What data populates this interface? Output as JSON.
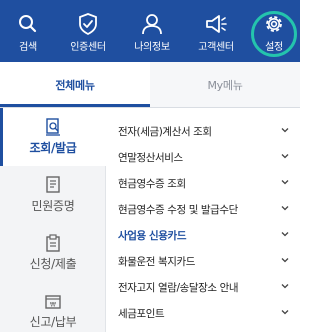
{
  "topbar": {
    "items": [
      {
        "label": "검색",
        "icon": "search-icon"
      },
      {
        "label": "인증센터",
        "icon": "shield-check-icon"
      },
      {
        "label": "나의정보",
        "icon": "user-icon"
      },
      {
        "label": "고객센터",
        "icon": "megaphone-icon"
      },
      {
        "label": "설정",
        "icon": "gear-icon"
      }
    ],
    "bg_color": "#1f4fa0",
    "highlight_ring_color": "#24c4ad"
  },
  "tabs": [
    {
      "label": "전체메뉴",
      "active": true
    },
    {
      "label": "My메뉴",
      "active": false
    }
  ],
  "categories": [
    {
      "label": "조회/발급",
      "icon": "document-search-icon",
      "active": true
    },
    {
      "label": "민원증명",
      "icon": "certificate-icon",
      "active": false
    },
    {
      "label": "신청/제출",
      "icon": "clipboard-icon",
      "active": false
    },
    {
      "label": "신고/납부",
      "icon": "tax-payment-icon",
      "active": false
    }
  ],
  "menu_items": [
    {
      "label": "전자(세금)계산서 조회",
      "highlight": false
    },
    {
      "label": "연말정산서비스",
      "highlight": false
    },
    {
      "label": "현금영수증 조회",
      "highlight": false
    },
    {
      "label": "현금영수증 수정 및 발급수단",
      "highlight": false
    },
    {
      "label": "사업용 신용카드",
      "highlight": true
    },
    {
      "label": "화물운전 복지카드",
      "highlight": false
    },
    {
      "label": "전자고지 열람/송달장소 안내",
      "highlight": false
    },
    {
      "label": "세금포인트",
      "highlight": false
    }
  ]
}
